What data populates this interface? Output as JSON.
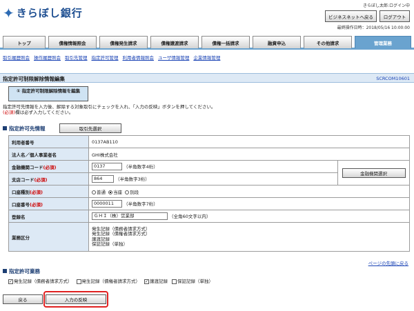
{
  "header": {
    "bank_name": "きらぼし銀行",
    "user_status": "きらぼし太郎:ログイン中",
    "business_net_button": "ビジネスネットへ戻る",
    "logout_button": "ログアウト",
    "last_operation": "最終操作日時：2018/05/16 10:00:00"
  },
  "tabs": [
    "トップ",
    "債権情報照会",
    "債権発生請求",
    "債権譲渡請求",
    "債権一括請求",
    "融資申込",
    "その他請求",
    "管理業務"
  ],
  "subnav": [
    "取引履歴照会",
    "操作履歴照会",
    "取引先管理",
    "指定許可管理",
    "利用者情報照会",
    "ユーザ情報管理",
    "企業情報管理"
  ],
  "page": {
    "title": "指定許可制限解除情報編集",
    "screen_code": "SCRCOM10601",
    "step": "① 指定許可制限解除情報を編集",
    "instruction1": "指定許可先情報を入力後、解除する対象取引にチェックを入れ、「入力の反映」ボタンを押してください。",
    "instruction2_req": "(必須)",
    "instruction2_rest": "欄は必ず入力してください。"
  },
  "section1": {
    "title": "指定許可先情報",
    "select_button": "取引先選択"
  },
  "form": {
    "user_no_label": "利用者番号",
    "user_no_value": "0137AB110",
    "corp_name_label": "法人名／個人事業者名",
    "corp_name_value": "GHI株式会社",
    "bank_code_label": "金融機関コード",
    "req": "(必須)",
    "bank_code_value": "0137",
    "bank_code_hint": "（半角数字4桁）",
    "bank_select_button": "金融機関選択",
    "branch_label": "支店コード",
    "branch_value": "864",
    "branch_hint": "（半角数字3桁）",
    "acct_type_label": "口座種別",
    "acct_types": [
      "普通",
      "当座",
      "別段"
    ],
    "acct_no_label": "口座番号",
    "acct_no_value": "0000011",
    "acct_no_hint": "（半角数字7桁）",
    "reg_name_label": "登録名",
    "reg_name_value": "ＧＨＩ（株）営業部",
    "reg_name_hint": "（全角60文字以内）",
    "biz_label": "業務区分",
    "biz_lines": [
      "発生記録（債務者請求方式）",
      "発生記録（債権者請求方式）",
      "譲渡記録",
      "保証記録（単独）"
    ]
  },
  "page_top_link": "ページの先頭に戻る",
  "section2": {
    "title": "指定許可業務",
    "checks": [
      {
        "label": "発生記録（債務者請求方式）",
        "checked": true
      },
      {
        "label": "発生記録（債権者請求方式）",
        "checked": false
      },
      {
        "label": "譲渡記録",
        "checked": true
      },
      {
        "label": "保証記録（単独）",
        "checked": false
      }
    ]
  },
  "footer": {
    "back_button": "戻る",
    "apply_button": "入力の反映"
  }
}
